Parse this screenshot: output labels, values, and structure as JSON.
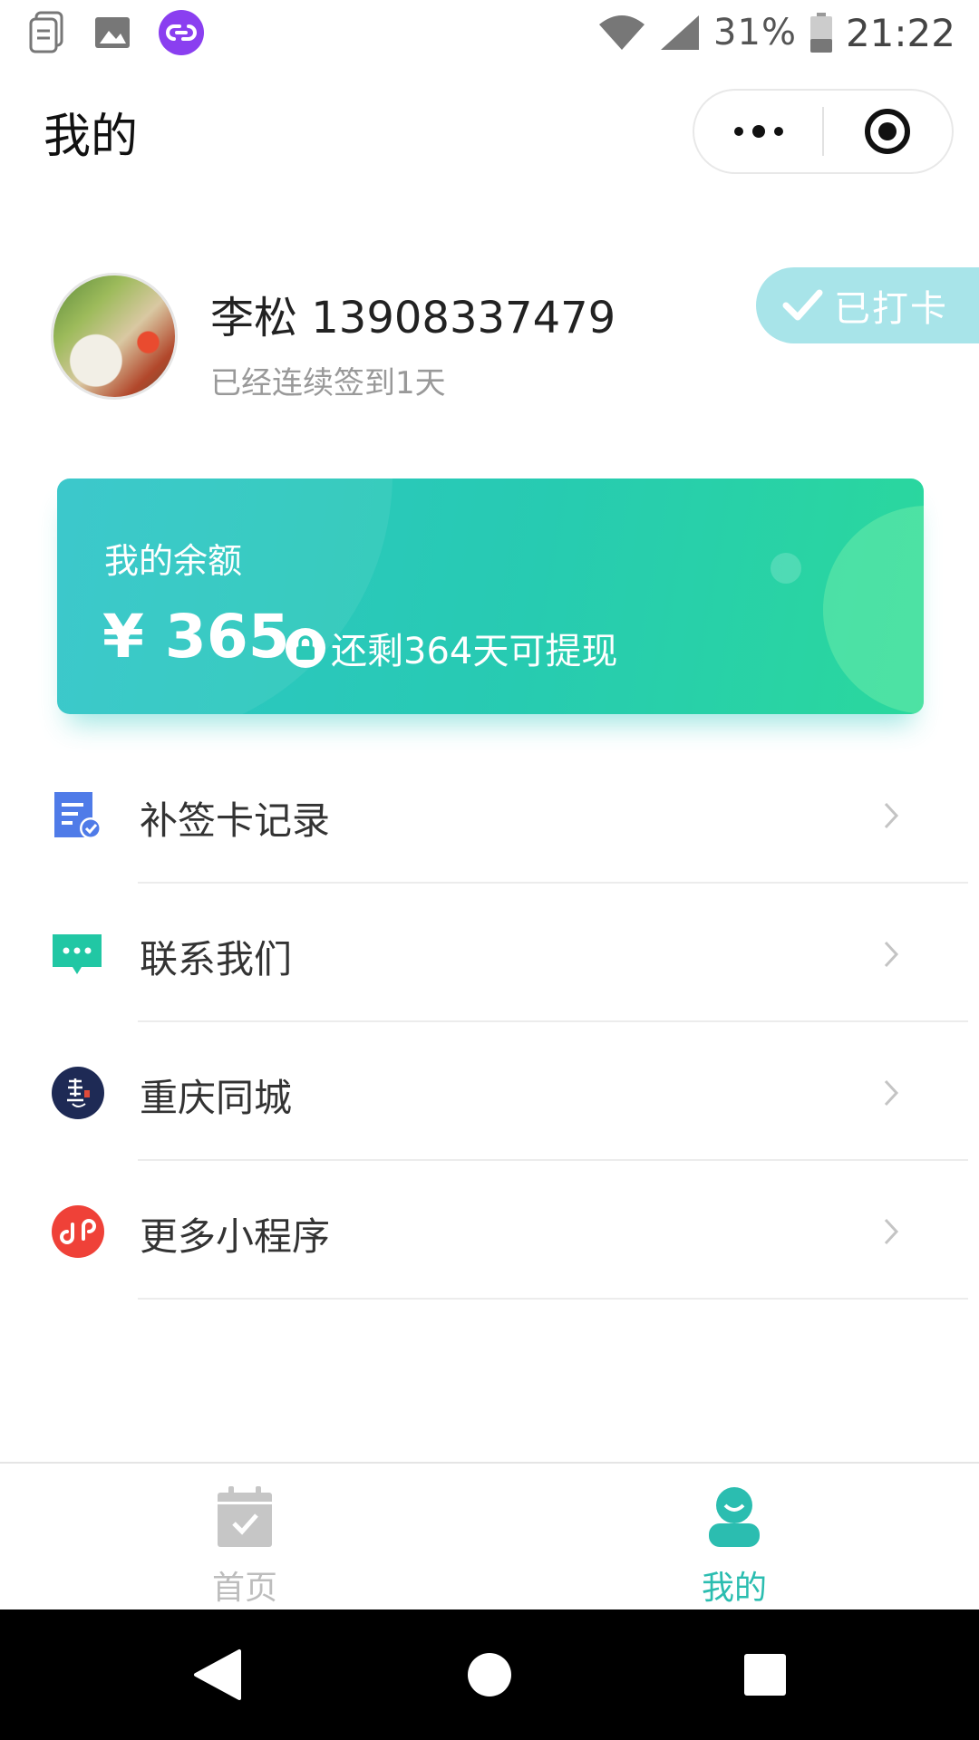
{
  "status_bar": {
    "battery": "31%",
    "time": "21:22",
    "left_icons": [
      "file-icon",
      "image-icon",
      "link-app-icon"
    ],
    "right_icons": [
      "wifi-icon",
      "signal-icon",
      "battery-icon"
    ]
  },
  "header": {
    "title": "我的",
    "more_icon": "more-dots-icon",
    "close_icon": "target-close-icon"
  },
  "profile": {
    "name": "李松 13908337479",
    "streak": "已经连续签到1天",
    "checked_label": "已打卡",
    "avatar": "avatar-vegetables"
  },
  "balance": {
    "label": "我的余额",
    "amount": "¥ 365",
    "withdraw_note": "还剩364天可提现",
    "colors": {
      "start": "#2ec4c8",
      "end": "#2ad89d"
    }
  },
  "menu": {
    "items": [
      {
        "label": "补签卡记录",
        "icon": "record-doc-icon",
        "icon_color": "#4f7be8"
      },
      {
        "label": "联系我们",
        "icon": "chat-bubble-icon",
        "icon_color": "#21c7a4"
      },
      {
        "label": "重庆同城",
        "icon": "chongqing-logo-icon",
        "icon_color": "#1e2a55"
      },
      {
        "label": "更多小程序",
        "icon": "mini-program-icon",
        "icon_color": "#ef4138"
      }
    ]
  },
  "tab_bar": {
    "tabs": [
      {
        "label": "首页",
        "icon": "calendar-check-icon",
        "active": false
      },
      {
        "label": "我的",
        "icon": "user-icon",
        "active": true
      }
    ],
    "active_color": "#2bbdb0",
    "inactive_color": "#bdbdbd"
  },
  "nav_bar": {
    "buttons": [
      "back-icon",
      "home-icon",
      "recents-icon"
    ]
  }
}
